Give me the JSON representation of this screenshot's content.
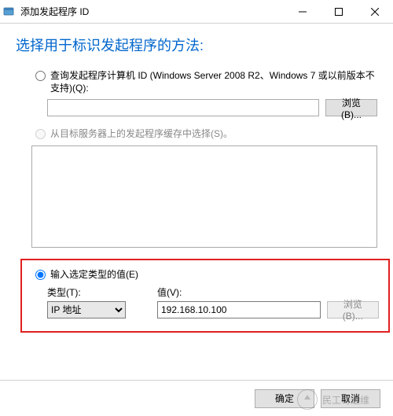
{
  "window": {
    "title": "添加发起程序 ID"
  },
  "heading": "选择用于标识发起程序的方法:",
  "option1": {
    "label": "查询发起程序计算机 ID (Windows Server 2008 R2、Windows 7 或以前版本不支持)(Q):",
    "input_value": "",
    "browse": "浏览(B)..."
  },
  "option2": {
    "label": "从目标服务器上的发起程序缓存中选择(S)。"
  },
  "option3": {
    "label": "输入选定类型的值(E)",
    "type_label": "类型(T):",
    "value_label": "值(V):",
    "type_selected": "IP 地址",
    "type_options": [
      "IP 地址"
    ],
    "value": "192.168.10.100",
    "browse": "浏览(B)..."
  },
  "footer": {
    "ok": "确定",
    "cancel": "取消"
  },
  "watermark": "民工哥运维"
}
